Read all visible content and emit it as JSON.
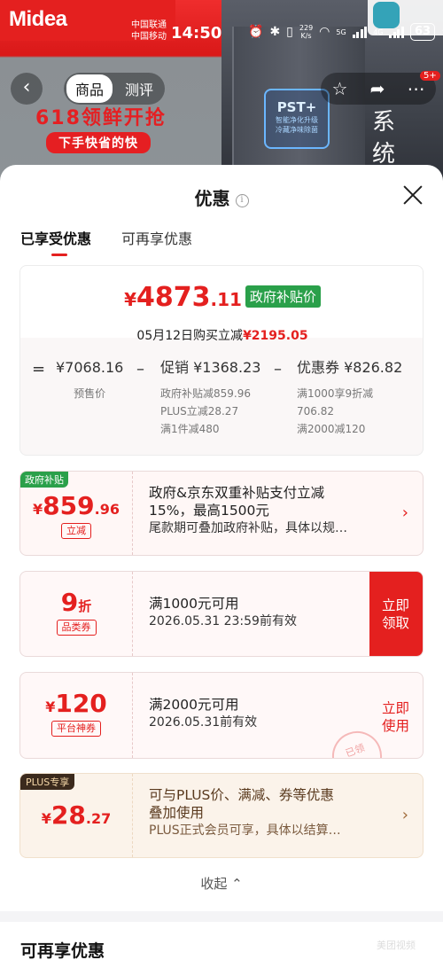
{
  "status_bar": {
    "carrier_1": "中国联通",
    "carrier_2": "中国移动",
    "time": "14:50",
    "speed": "229",
    "speed_unit": "K/s",
    "network": "5G",
    "network_2": "4G",
    "battery": "63"
  },
  "background": {
    "brand": "Midea",
    "promo_title": "618领鲜开抢",
    "promo_sub": "下手快省的快",
    "badge_title": "PST+",
    "badge_line1": "智能净化升级",
    "badge_line2": "冷藏净味除菌",
    "right_text": "系统"
  },
  "nav": {
    "back": "‹",
    "tab_goods": "商品",
    "tab_reviews": "测评",
    "badge": "5+"
  },
  "sheet": {
    "title": "优惠",
    "tabs": [
      "已享受优惠",
      "可再享优惠"
    ],
    "summary": {
      "currency": "¥",
      "price_int": "4873",
      "price_dec": ".11",
      "gov_tag": "政府补贴价",
      "sub_prefix": "05月12日购买立减",
      "sub_amount": "¥2195.05",
      "eq": "=",
      "minus": "–",
      "presale_value": "¥7068.16",
      "presale_label": "预售价",
      "promo_head": "促销 ¥1368.23",
      "promo_lines": [
        "政府补贴减859.96",
        "PLUS立减28.27",
        "满1件减480"
      ],
      "coupon_head": "优惠券 ¥826.82",
      "coupon_lines": [
        "满1000享9折减",
        "706.82",
        "满2000减120"
      ]
    },
    "card_gov": {
      "corner": "政府补贴",
      "currency": "¥",
      "amount_int": "859",
      "amount_dec": ".96",
      "label": "立减",
      "line1": "政府&京东双重补贴支付立减",
      "line2": "15%，最高1500元",
      "line3": "尾款期可叠加政府补贴，具体以规…"
    },
    "card_discount": {
      "amount": "9",
      "unit": "折",
      "label": "品类券",
      "line1": "满1000元可用",
      "line2": "2026.05.31 23:59前有效",
      "action_1": "立即",
      "action_2": "领取"
    },
    "card_platform": {
      "currency": "¥",
      "amount": "120",
      "label": "平台神券",
      "line1": "满2000元可用",
      "line2": "2026.05.31前有效",
      "action_1": "立即",
      "action_2": "使用",
      "stamp": "已领"
    },
    "card_plus": {
      "corner": "PLUS专享",
      "currency": "¥",
      "amount_int": "28",
      "amount_dec": ".27",
      "line1": "可与PLUS价、满减、券等优惠",
      "line2": "叠加使用",
      "line3": "PLUS正式会员可享，具体以结算…"
    },
    "collapse": "收起",
    "more_title": "可再享优惠",
    "watermark": "美团视频"
  },
  "colors": {
    "accent": "#e4201f",
    "gov_green": "#2aa04a"
  }
}
